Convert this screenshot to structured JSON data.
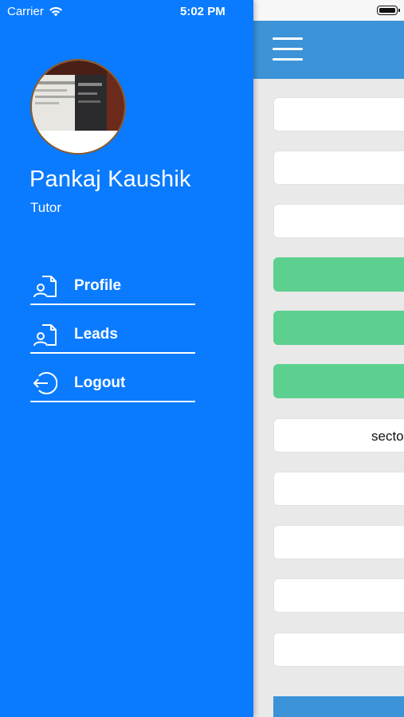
{
  "status_bar": {
    "carrier": "Carrier",
    "time": "5:02 PM"
  },
  "profile": {
    "name": "Pankaj Kaushik",
    "role": "Tutor"
  },
  "menu": [
    {
      "label": "Profile",
      "icon": "profile-doc-icon"
    },
    {
      "label": "Leads",
      "icon": "leads-doc-icon"
    },
    {
      "label": "Logout",
      "icon": "logout-icon"
    }
  ],
  "content": {
    "sector_field_text": "secto"
  },
  "colors": {
    "drawer_bg": "#0a7bff",
    "navbar_bg": "#3c93d8",
    "green_button": "#5dd08f",
    "content_bg": "#e9e9e9"
  }
}
